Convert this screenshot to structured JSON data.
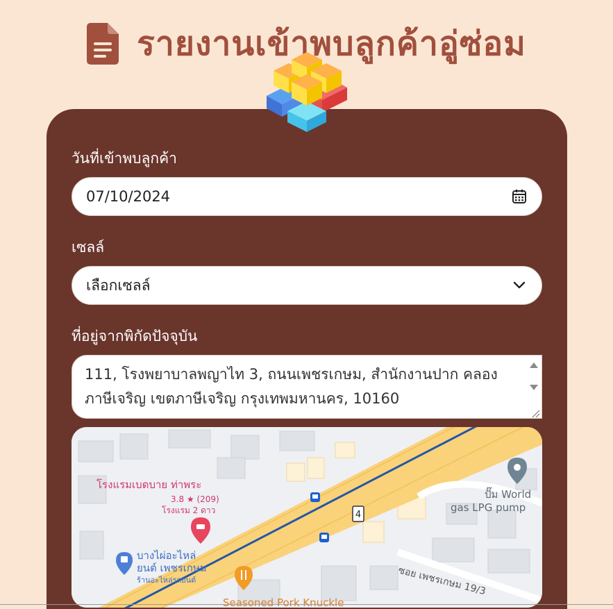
{
  "header": {
    "title": "รายงานเข้าพบลูกค้าอู่ซ่อม",
    "icon": "document-icon",
    "logo": "blocks-logo"
  },
  "form": {
    "date_label": "วันที่เข้าพบลูกค้า",
    "date_value": "07/10/2024",
    "date_icon": "calendar-icon",
    "sales_label": "เซลล์",
    "sales_value": "เลือกเซลล์",
    "sales_icon": "chevron-down-icon",
    "address_label": "ที่อยู่จากพิกัดปัจจุบัน",
    "address_value": "111, โรงพยาบาลพญาไท 3, ถนนเพชรเกษม, สำนักงานปาก คลองภาษีเจริญ เขตภาษีเจริญ กรุงเทพมหานคร, 10160"
  },
  "map": {
    "hotel_name": "โรงแรมเบดบาย ท่าพระ",
    "hotel_rating": "3.8 ★ (209)",
    "hotel_type": "โรงแรม 2 ดาว",
    "shop_name_1": "บางไผ่อะไหล่",
    "shop_name_2": "ยนต์ เพชรเกษม",
    "shop_type": "ร้านอะไหล่รถยนต์",
    "pump_name_1": "ปั๊ม World",
    "pump_name_2": "gas LPG pump",
    "soi_label": "ซอย เพชรเกษม 19/3",
    "restaurant": "Seasoned Pork Knuckle",
    "route_number": "4",
    "colors": {
      "road": "#f9d27a",
      "rail": "#2457a6",
      "pin_red": "#e8455f",
      "pin_blue": "#4e7fd6",
      "pin_orange": "#f29b26",
      "pin_grey": "#6f8593"
    }
  },
  "colors": {
    "background": "#fbe6d4",
    "card": "#6a352b",
    "title": "#a0503d"
  }
}
